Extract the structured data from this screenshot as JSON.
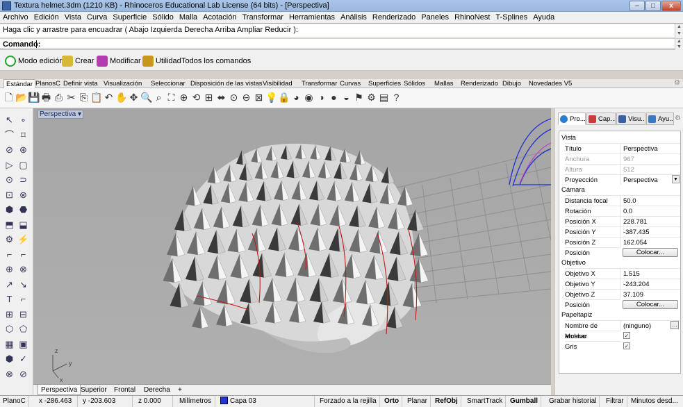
{
  "window": {
    "title": "Textura helmet.3dm (1210 KB) - Rhinoceros Educational Lab License (64 bits) - [Perspectiva]",
    "minimize": "–",
    "maximize": "□",
    "close": "x"
  },
  "menu": [
    "Archivo",
    "Edición",
    "Vista",
    "Curva",
    "Superficie",
    "Sólido",
    "Malla",
    "Acotación",
    "Transformar",
    "Herramientas",
    "Análisis",
    "Renderizado",
    "Paneles",
    "RhinoNest",
    "T-Splines",
    "Ayuda"
  ],
  "history": {
    "text": "Haga clic y arrastre para encuadrar ( Abajo  Izquierda  Derecha  Arriba  Ampliar  Reducir ):"
  },
  "command": {
    "label": "Comando:"
  },
  "tsplines": {
    "items": [
      {
        "label": "Modo edición",
        "color": "#26a12e"
      },
      {
        "label": "Crear",
        "color": "#c9a728"
      },
      {
        "label": "Modificar",
        "color": "#b33cb0"
      },
      {
        "label": "Utilidad",
        "color": "#c8961d"
      },
      {
        "label": "Todos los comandos",
        "color": ""
      }
    ]
  },
  "tabs": [
    "Estándar",
    "PlanosC",
    "Definir vista",
    "Visualización",
    "Seleccionar",
    "Disposición de las vistas",
    "Visibilidad",
    "Transformar",
    "Curvas",
    "Superficies",
    "Sólidos",
    "Mallas",
    "Renderizado",
    "Dibujo",
    "Novedades V5"
  ],
  "viewport": {
    "title": "Perspectiva"
  },
  "viewport_tabs": [
    "Perspectiva",
    "Superior",
    "Frontal",
    "Derecha",
    "+"
  ],
  "panel": {
    "tabs": [
      {
        "label": "Pro...",
        "color": "#2a7fd3"
      },
      {
        "label": "Cap...",
        "color": "#cc3b3b"
      },
      {
        "label": "Visu...",
        "color": "#3a5fa6"
      },
      {
        "label": "Ayu...",
        "color": "#3a79c2"
      }
    ],
    "sections": {
      "vista": "Vista",
      "camara": "Cámara",
      "objetivo": "Objetivo",
      "papeltapiz": "Papeltapiz"
    },
    "rows": {
      "titulo": {
        "k": "Título",
        "v": "Perspectiva"
      },
      "anchura": {
        "k": "Anchura",
        "v": "967"
      },
      "altura": {
        "k": "Altura",
        "v": "512"
      },
      "proyeccion": {
        "k": "Proyección",
        "v": "Perspectiva"
      },
      "distancia": {
        "k": "Distancia focal",
        "v": "50.0"
      },
      "rotacion": {
        "k": "Rotación",
        "v": "0.0"
      },
      "posx": {
        "k": "Posición X",
        "v": "228.781"
      },
      "posy": {
        "k": "Posición Y",
        "v": "-387.435"
      },
      "posz": {
        "k": "Posición Z",
        "v": "162.054"
      },
      "posicion": {
        "k": "Posición",
        "v": "Colocar..."
      },
      "objx": {
        "k": "Objetivo X",
        "v": "1.515"
      },
      "objy": {
        "k": "Objetivo Y",
        "v": "-243.204"
      },
      "objz": {
        "k": "Objetivo Z",
        "v": "37.109"
      },
      "posicion2": {
        "k": "Posición",
        "v": "Colocar..."
      },
      "archivo": {
        "k": "Nombre de archivo",
        "v": "(ninguno)"
      },
      "mostrar": {
        "k": "Mostrar",
        "v": "✓"
      },
      "gris": {
        "k": "Gris",
        "v": "✓"
      }
    }
  },
  "status": {
    "cplane": "PlanoC",
    "x": "x -286.463",
    "y": "y -203.603",
    "z": "z 0.000",
    "units": "Milímetros",
    "layer": "Capa 03",
    "layer_color": "#2136d4",
    "snap": "Forzado a la rejilla",
    "orto": "Orto",
    "planar": "Planar",
    "refobj": "RefObj",
    "smarttrack": "SmartTrack",
    "gumball": "Gumball",
    "history": "Grabar historial",
    "filter": "Filtrar",
    "minutes": "Minutos desd..."
  }
}
